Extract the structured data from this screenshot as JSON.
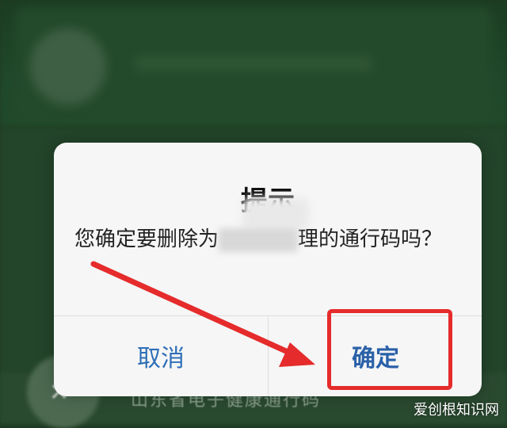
{
  "dialog": {
    "title": "提示",
    "message_prefix": "您确定要删除为",
    "message_suffix": "理的通行码吗？",
    "cancel_label": "取消",
    "confirm_label": "确定"
  },
  "background": {
    "bottom_text": "山东省电子健康通行码"
  },
  "watermark": "爱创根知识网",
  "colors": {
    "annotation_red": "#e52b2b",
    "button_blue": "#2a61a8",
    "background_green": "#1f3a22"
  }
}
